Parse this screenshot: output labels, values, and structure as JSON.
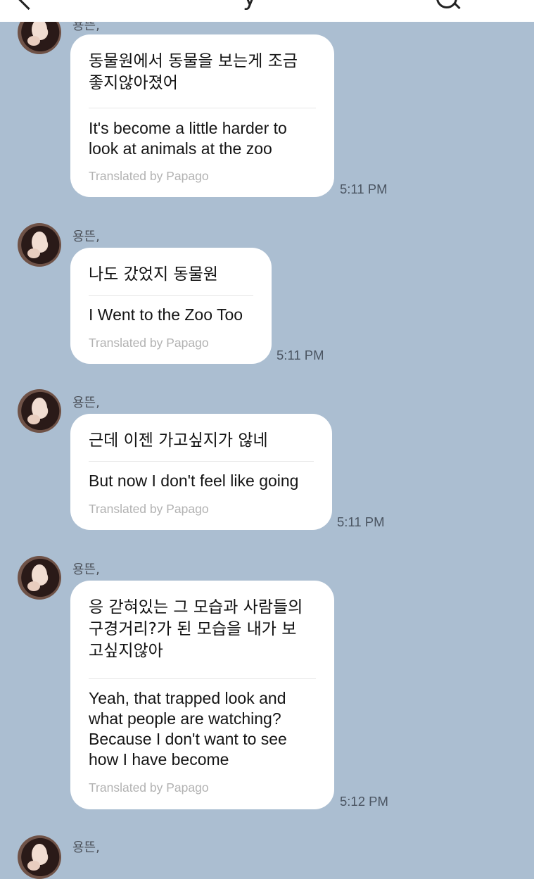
{
  "header": {
    "title_fragment": "y"
  },
  "messages": [
    {
      "sender": "용뜬,",
      "korean": "동물원에서 동물을 보는게 조금\n좋지않아졌어",
      "english": "It's become a little harder to\nlook at animals at the zoo",
      "translated_by": "Translated by Papago",
      "time": "5:11 PM"
    },
    {
      "sender": "용뜬,",
      "korean": "나도 갔었지 동물원",
      "english": "I Went to the Zoo Too",
      "translated_by": "Translated by Papago",
      "time": "5:11 PM"
    },
    {
      "sender": "용뜬,",
      "korean": "근데 이젠 가고싶지가 않네",
      "english": "But now I don't feel like going",
      "translated_by": "Translated by Papago",
      "time": "5:11 PM"
    },
    {
      "sender": "용뜬,",
      "korean": "응 갇혀있는 그 모습과 사람들의\n구경거리?가 된 모습을 내가 보\n고싶지않아",
      "english": "Yeah, that trapped look and\nwhat people are watching?\nBecause I don't want to see\nhow I have become",
      "translated_by": "Translated by Papago",
      "time": "5:12 PM"
    },
    {
      "sender": "용뜬,"
    }
  ]
}
